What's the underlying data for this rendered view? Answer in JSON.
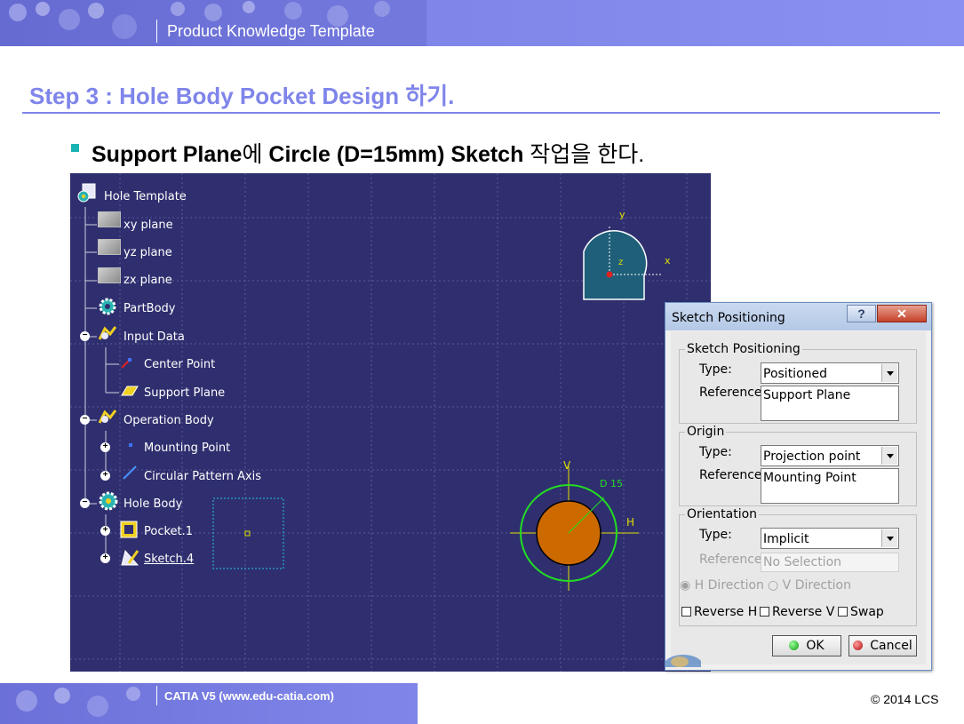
{
  "header": {
    "title": "Product Knowledge Template"
  },
  "page": {
    "title": "Step 3 : Hole Body Pocket Design 하기.",
    "bullet_bold": "Support Plane",
    "bullet_kor1": "에 ",
    "bullet_bold2": "Circle (D=15mm) Sketch",
    "bullet_kor2": " 작업을 한다."
  },
  "tree": {
    "root": "Hole Template",
    "items": [
      "xy plane",
      "yz plane",
      "zx plane",
      "PartBody",
      "Input Data",
      "Center Point",
      "Support Plane",
      "Operation Body",
      "Mounting Point",
      "Circular Pattern Axis",
      "Hole Body",
      "Pocket.1",
      "Sketch.4"
    ]
  },
  "viewport": {
    "axis_y": "y",
    "axis_z": "z",
    "axis_x": "x",
    "sketch_v": "V",
    "sketch_h": "H",
    "dimension": "D 15"
  },
  "dialog": {
    "title": "Sketch Positioning",
    "help_label": "?",
    "close_label": "✕",
    "group1": {
      "legend": "Sketch Positioning",
      "type_label": "Type:",
      "type_value": "Positioned",
      "ref_label": "Reference:",
      "ref_value": "Support Plane"
    },
    "group2": {
      "legend": "Origin",
      "type_label": "Type:",
      "type_value": "Projection point",
      "ref_label": "Reference:",
      "ref_value": "Mounting Point"
    },
    "group3": {
      "legend": "Orientation",
      "type_label": "Type:",
      "type_value": "Implicit",
      "ref_label": "Reference:",
      "ref_value": "No Selection",
      "h_dir": "H Direction",
      "v_dir": "V Direction",
      "rev_h": "Reverse H",
      "rev_v": "Reverse V",
      "swap": "Swap"
    },
    "ok": "OK",
    "cancel": "Cancel"
  },
  "footer": {
    "left": "CATIA V5 (www.edu-catia.com)",
    "right": "© 2014 LCS"
  },
  "colors": {
    "accent": "#7f85ea",
    "viewport_bg": "#2f2f6f",
    "circle_fill": "#cc6a00",
    "circle_outline": "#22dd22"
  }
}
